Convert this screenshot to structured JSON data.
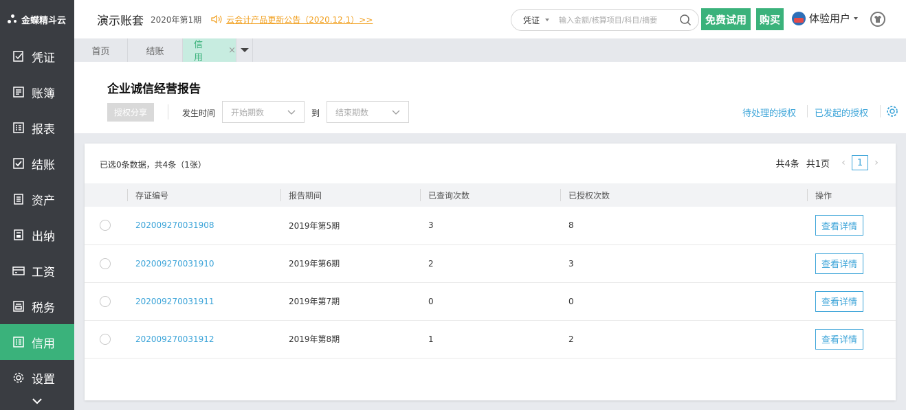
{
  "sidebar": {
    "logo": "金蝶精斗云",
    "items": [
      {
        "label": "凭证",
        "icon": "voucher-icon"
      },
      {
        "label": "账簿",
        "icon": "ledger-icon"
      },
      {
        "label": "报表",
        "icon": "report-icon"
      },
      {
        "label": "结账",
        "icon": "checkout-icon"
      },
      {
        "label": "资产",
        "icon": "asset-icon"
      },
      {
        "label": "出纳",
        "icon": "cashier-icon"
      },
      {
        "label": "工资",
        "icon": "salary-icon"
      },
      {
        "label": "税务",
        "icon": "tax-icon"
      },
      {
        "label": "信用",
        "icon": "credit-icon",
        "active": true
      },
      {
        "label": "设置",
        "icon": "gear-icon"
      }
    ]
  },
  "header": {
    "account_title": "演示账套",
    "period": "2020年第1期",
    "notice": "云会计产品更新公告（2020.12.1）>>",
    "search": {
      "type": "凭证",
      "placeholder": "输入金额/核算项目/科目/摘要"
    },
    "trial_label": "免费试用",
    "buy_label": "购买",
    "user_name": "体验用户"
  },
  "tabs": [
    {
      "label": "首页"
    },
    {
      "label": "结账"
    },
    {
      "label": "信用",
      "active": true,
      "close": "×"
    }
  ],
  "page": {
    "title": "企业诚信经营报告",
    "share_label": "授权分享",
    "time_label": "发生时间",
    "start_placeholder": "开始期数",
    "to_label": "到",
    "end_placeholder": "结束期数",
    "pending_link": "待处理的授权",
    "sent_link": "已发起的授权"
  },
  "table": {
    "selection_info": "已选0条数据，共4条（1张）",
    "pager": {
      "total": "共4条",
      "pages": "共1页",
      "current": "1"
    },
    "columns": [
      "存证编号",
      "报告期间",
      "已查询次数",
      "已授权次数",
      "操作"
    ],
    "rows": [
      {
        "id": "202009270031908",
        "period": "2019年第5期",
        "queries": "3",
        "auths": "8",
        "action": "查看详情"
      },
      {
        "id": "202009270031910",
        "period": "2019年第6期",
        "queries": "2",
        "auths": "3",
        "action": "查看详情"
      },
      {
        "id": "202009270031911",
        "period": "2019年第7期",
        "queries": "0",
        "auths": "0",
        "action": "查看详情"
      },
      {
        "id": "202009270031912",
        "period": "2019年第8期",
        "queries": "1",
        "auths": "2",
        "action": "查看详情"
      }
    ]
  },
  "colors": {
    "accent": "#3ab27b",
    "link": "#3aa3d8",
    "notice": "#f1a020",
    "sidebar": "#3a3d42"
  }
}
